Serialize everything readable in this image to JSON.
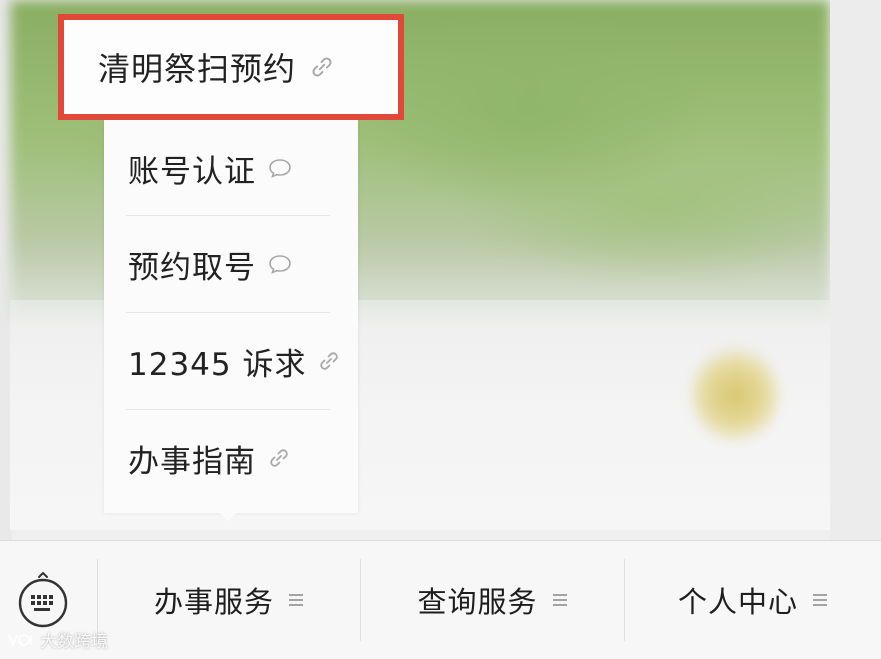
{
  "menu": {
    "highlighted_item": {
      "label": "清明祭扫预约",
      "icon": "link-icon"
    },
    "items": [
      {
        "label": "账号认证",
        "icon": "chat-bubble-icon"
      },
      {
        "label": "预约取号",
        "icon": "chat-bubble-icon"
      },
      {
        "label": "12345 诉求",
        "icon": "link-icon"
      },
      {
        "label": "办事指南",
        "icon": "link-icon"
      }
    ],
    "highlight_color": "#e1483a"
  },
  "bottom_bar": {
    "keyboard_icon": "keyboard-icon",
    "tabs": [
      {
        "label": "办事服务",
        "icon": "hamburger-icon"
      },
      {
        "label": "查询服务",
        "icon": "hamburger-icon"
      },
      {
        "label": "个人中心",
        "icon": "hamburger-icon"
      }
    ]
  },
  "watermark": {
    "text": "大数跨境"
  }
}
